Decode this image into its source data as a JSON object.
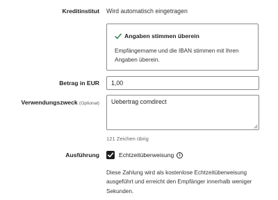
{
  "creditor_institute": {
    "label": "Kreditinstitut",
    "value": "Wird automatisch eingetragen"
  },
  "verification": {
    "icon": "checkmark-icon",
    "title": "Angaben stimmen überein",
    "text": "Empfängername und die IBAN stimmen mit Ihren Angaben überein."
  },
  "amount": {
    "label": "Betrag in EUR",
    "value": "1,00"
  },
  "purpose": {
    "label": "Verwendungszweck",
    "optional": "(Optional)",
    "value": "Uebertrag comdirect",
    "counter": "121 Zeichen übrig"
  },
  "execution": {
    "label": "Ausführung",
    "checkbox_label": "Echtzeitüberweisung",
    "checked": true,
    "info_icon": "info-icon",
    "description": "Diese Zahlung wird als kostenlose Echtzeitüberweisung ausgeführt und erreicht den Empfänger innerhalb weniger Sekunden."
  }
}
